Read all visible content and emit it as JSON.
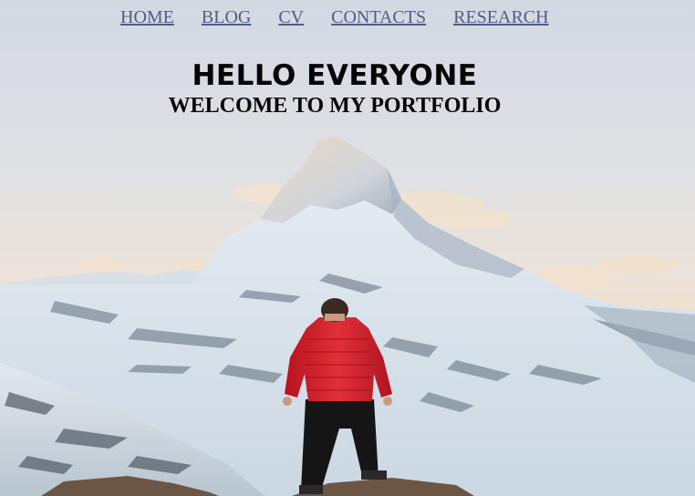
{
  "nav": {
    "items": [
      {
        "label": "HOME"
      },
      {
        "label": "BLOG"
      },
      {
        "label": "CV"
      },
      {
        "label": "CONTACTS"
      },
      {
        "label": "RESEARCH"
      }
    ]
  },
  "hero": {
    "title": "HELLO EVERYONE",
    "subtitle": "WELCOME TO MY PORTFOLIO"
  },
  "colors": {
    "link": "#4d5f86",
    "heading": "#060606",
    "jacket": "#d8232f"
  }
}
